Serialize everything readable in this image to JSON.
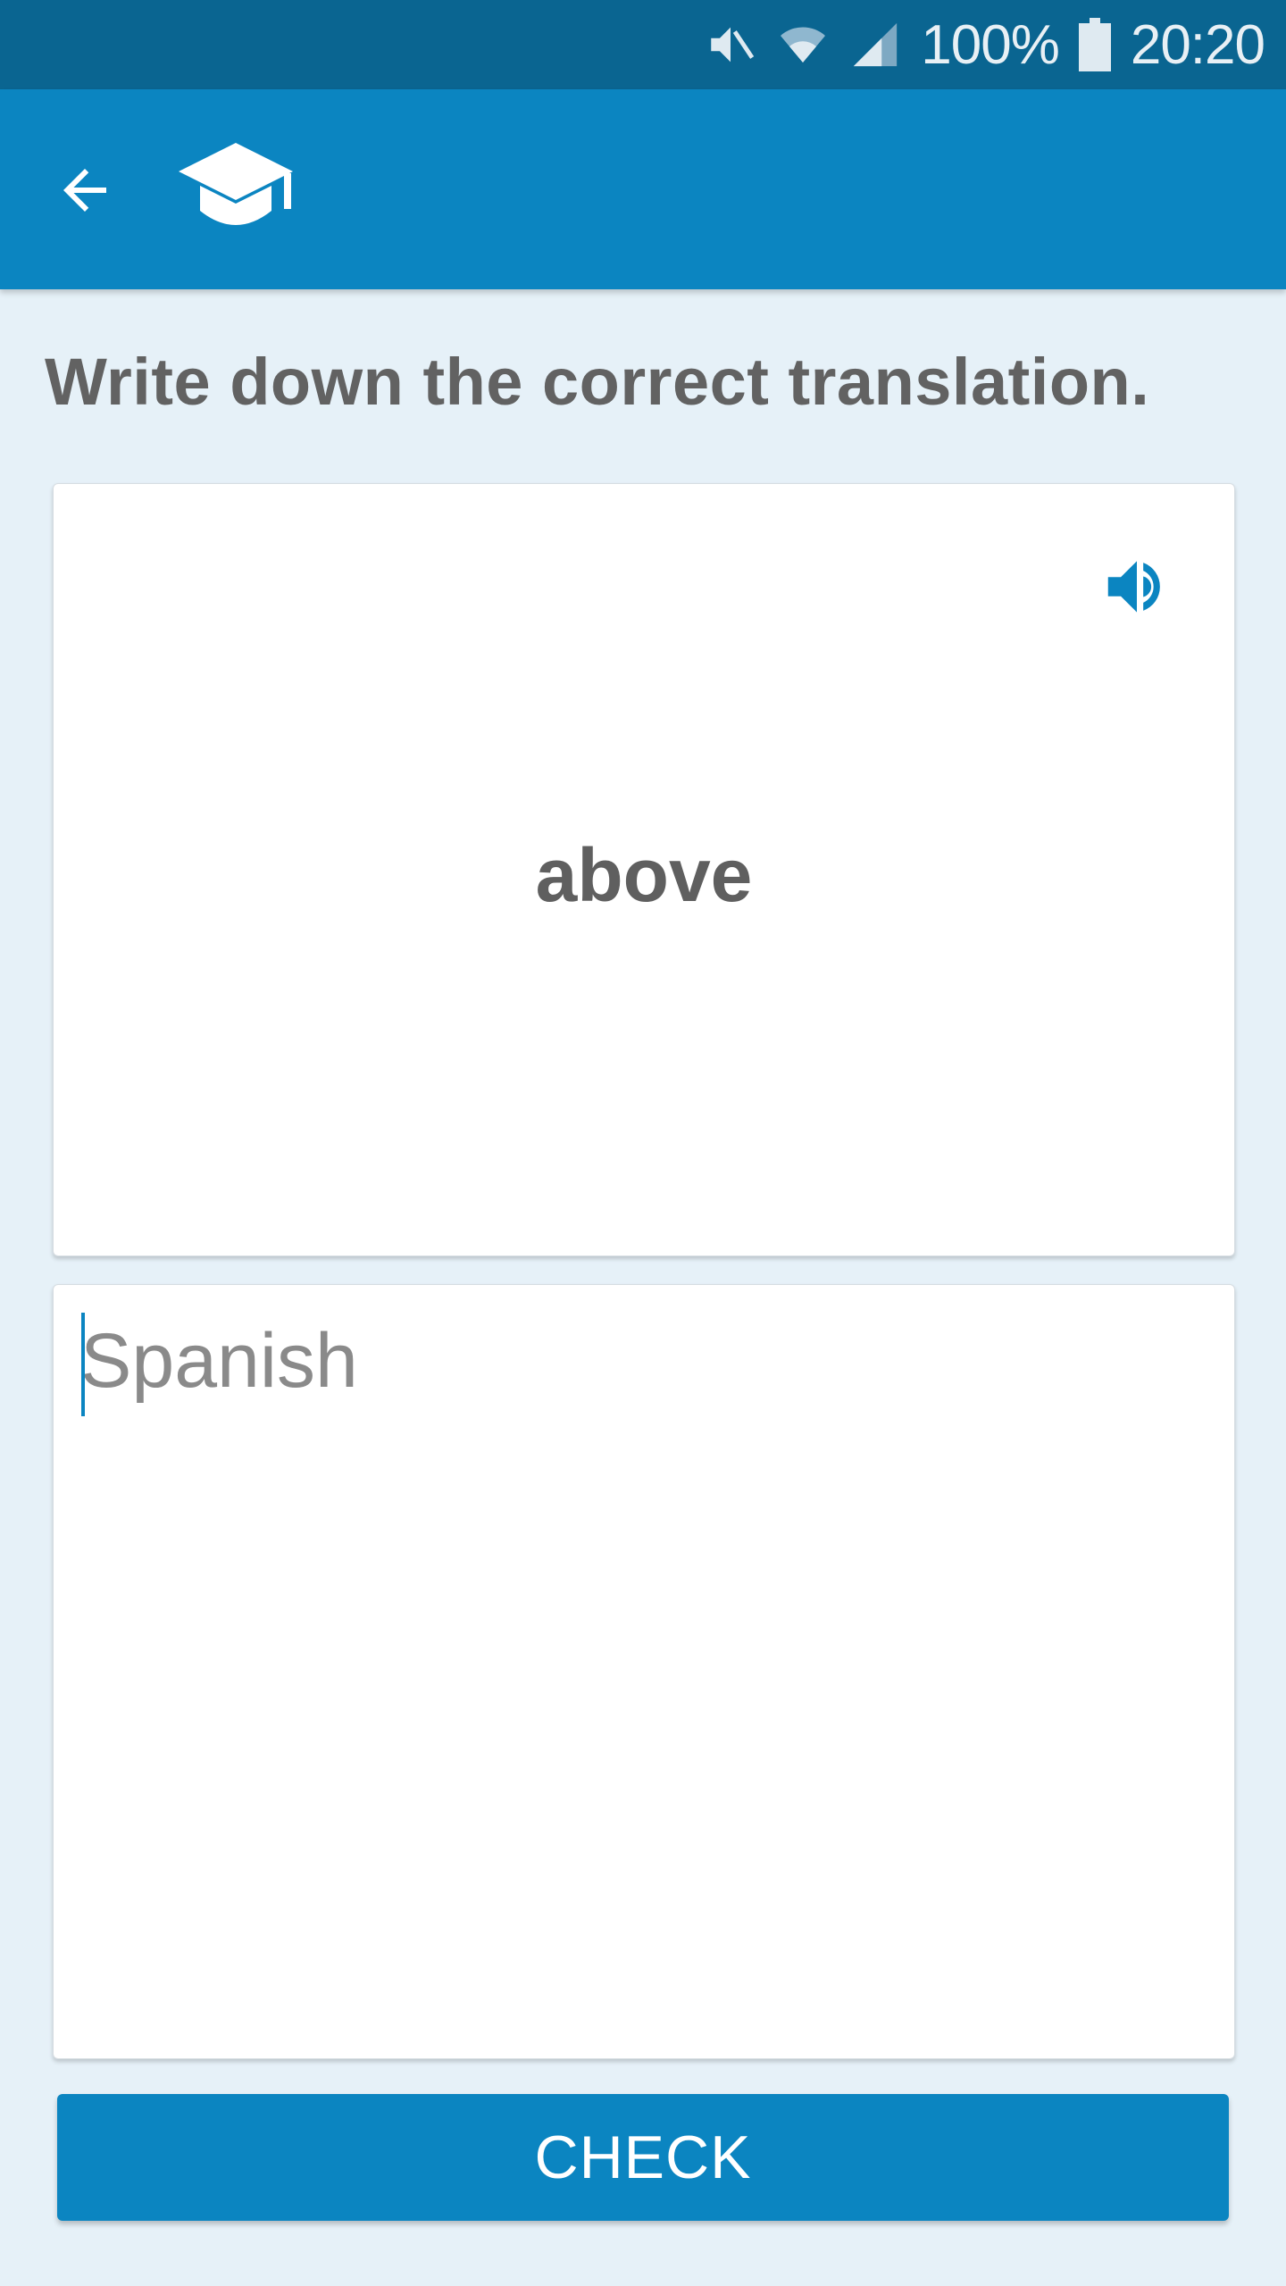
{
  "status_bar": {
    "battery": "100%",
    "time": "20:20",
    "icons": [
      "mute-icon",
      "wifi-icon",
      "signal-icon",
      "battery-icon"
    ]
  },
  "app_bar": {
    "icons": [
      "back-arrow-icon",
      "graduation-cap-icon"
    ]
  },
  "exercise": {
    "instruction": "Write down the correct translation.",
    "word": "above",
    "speaker_icon": "speaker-icon"
  },
  "answer": {
    "value": "",
    "placeholder": "Spanish"
  },
  "check_label": "CHECK",
  "colors": {
    "status_bar": "#0a6591",
    "app_bar": "#0b85c1",
    "background": "#e6f1f8",
    "accent": "#0b85c1",
    "text": "#626262"
  }
}
